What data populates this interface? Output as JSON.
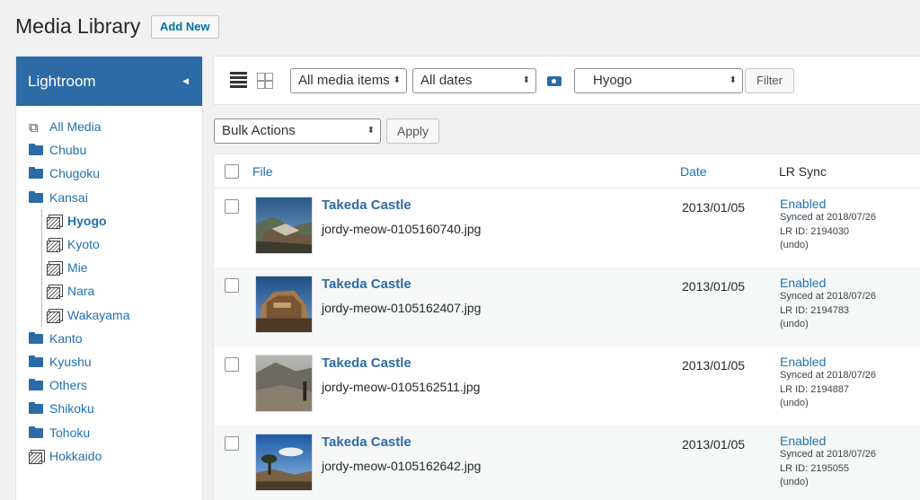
{
  "header": {
    "title": "Media Library",
    "add_new": "Add New"
  },
  "sidebar": {
    "title": "Lightroom",
    "items": [
      {
        "label": "All Media",
        "type": "media",
        "level": 0
      },
      {
        "label": "Chubu",
        "type": "folder",
        "level": 0
      },
      {
        "label": "Chugoku",
        "type": "folder",
        "level": 0
      },
      {
        "label": "Kansai",
        "type": "folder",
        "level": 0
      },
      {
        "label": "Hyogo",
        "type": "collection",
        "level": 1,
        "selected": true
      },
      {
        "label": "Kyoto",
        "type": "collection",
        "level": 1
      },
      {
        "label": "Mie",
        "type": "collection",
        "level": 1
      },
      {
        "label": "Nara",
        "type": "collection",
        "level": 1
      },
      {
        "label": "Wakayama",
        "type": "collection",
        "level": 1
      },
      {
        "label": "Kanto",
        "type": "folder",
        "level": 0
      },
      {
        "label": "Kyushu",
        "type": "folder",
        "level": 0
      },
      {
        "label": "Others",
        "type": "folder",
        "level": 0
      },
      {
        "label": "Shikoku",
        "type": "folder",
        "level": 0
      },
      {
        "label": "Tohoku",
        "type": "folder",
        "level": 0
      },
      {
        "label": "Hokkaido",
        "type": "collection",
        "level": 0
      }
    ]
  },
  "toolbar": {
    "media_filter": "All media items",
    "date_filter": "All dates",
    "folder_filter": "Hyogo",
    "filter_button": "Filter"
  },
  "bulk": {
    "action": "Bulk Actions",
    "apply": "Apply"
  },
  "table": {
    "columns": {
      "file": "File",
      "date": "Date",
      "sync": "LR Sync"
    },
    "rows": [
      {
        "title": "Takeda Castle",
        "file": "jordy-meow-0105160740.jpg",
        "date": "2013/01/05",
        "status": "Enabled",
        "synced": "Synced at 2018/07/26",
        "lrid": "LR ID: 2194030",
        "undo": "(undo)"
      },
      {
        "title": "Takeda Castle",
        "file": "jordy-meow-0105162407.jpg",
        "date": "2013/01/05",
        "status": "Enabled",
        "synced": "Synced at 2018/07/26",
        "lrid": "LR ID: 2194783",
        "undo": "(undo)"
      },
      {
        "title": "Takeda Castle",
        "file": "jordy-meow-0105162511.jpg",
        "date": "2013/01/05",
        "status": "Enabled",
        "synced": "Synced at 2018/07/26",
        "lrid": "LR ID: 2194887",
        "undo": "(undo)"
      },
      {
        "title": "Takeda Castle",
        "file": "jordy-meow-0105162642.jpg",
        "date": "2013/01/05",
        "status": "Enabled",
        "synced": "Synced at 2018/07/26",
        "lrid": "LR ID: 2195055",
        "undo": "(undo)"
      }
    ]
  },
  "colors": {
    "accent": "#2d6ba6",
    "link": "#2271b1"
  }
}
